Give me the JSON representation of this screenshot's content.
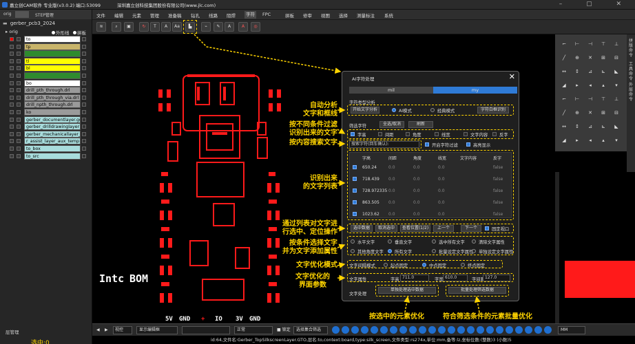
{
  "titlebar": {
    "app_title": "嘉立创CAM软件 专业版(v3.0.2) 端口:53099",
    "company": "深圳嘉立创科技集团股份有限公司(www.jlc.com)"
  },
  "left_panel": {
    "tabs": [
      "orig",
      "",
      "STEP管理"
    ],
    "project": "gerber_pcb3_2024",
    "header_left": "orig",
    "header_outline": "外形线",
    "header_board": "拼板",
    "layers": [
      {
        "name": "to",
        "color": "#ffffff"
      },
      {
        "name": "tp",
        "color": "#c8b46a"
      },
      {
        "name": "",
        "color": "#2e8b2e"
      },
      {
        "name": "tl",
        "color": "#ffff00"
      },
      {
        "name": "bl",
        "color": "#ffff00"
      },
      {
        "name": "",
        "color": "#2e8b2e"
      },
      {
        "name": "bo",
        "color": "#ffffff"
      },
      {
        "name": "drill_pth_through.drl",
        "color": "#9a9a9a"
      },
      {
        "name": "drill_pth_through_via.drl",
        "color": "#9a9a9a"
      },
      {
        "name": "drill_npth_through.drl",
        "color": "#9a9a9a"
      },
      {
        "name": "ko",
        "color": "#9a9a9a"
      },
      {
        "name": "gerber_documentlayer.gd",
        "color": "#a8dcdc"
      },
      {
        "name": "gerber_drilldrawinglayer",
        "color": "#a8dcdc"
      },
      {
        "name": "gerber_mechanicallayer_",
        "color": "#a8dcdc"
      },
      {
        "name": "r_assist_layer_aux_temp",
        "color": "#a8dcdc"
      },
      {
        "name": "to_box",
        "color": "#a8dcdc"
      },
      {
        "name": "to_src",
        "color": "#a8dcdc"
      }
    ],
    "layer_manager": "层管理",
    "selected_count": "选中:0"
  },
  "menu": [
    "文件",
    "编辑",
    "元素",
    "管理",
    "准备稿",
    "钻孔",
    "线路",
    "阻焊",
    "字符",
    "FPC",
    "拼板",
    "修审",
    "视图",
    "选择",
    "测量标注",
    "系统"
  ],
  "menu_active_index": 8,
  "toolbar": {
    "buttons": [
      "layers-icon",
      "zoom-icon",
      "panel-icon",
      "rotate-icon",
      "text-icon",
      "text-A-icon",
      "text-Aa-icon",
      "ai-text-icon",
      "ai-text-process-icon",
      "edit-text-icon",
      "font-icon",
      "text-A-red-icon",
      "target-icon"
    ]
  },
  "dialog": {
    "title": "AI字符处理",
    "modes": [
      "mil",
      "my"
    ],
    "active_mode": "my",
    "section_type": "字符类型分析",
    "btn_start_analysis": "开始文字分析",
    "radio_ai": "AI模式",
    "radio_classic": "经典模式",
    "btn_text_config": "字符白框识别",
    "section_filter": "筛选字符",
    "btn_select_all": "全选/取消",
    "btn_refresh": "刷新",
    "filters": [
      {
        "label": "字高",
        "checked": true
      },
      {
        "label": "间距",
        "checked": false
      },
      {
        "label": "角度",
        "checked": false
      },
      {
        "label": "线宽",
        "checked": false
      },
      {
        "label": "文字内容",
        "checked": false
      },
      {
        "label": "反字",
        "checked": false
      }
    ],
    "search_placeholder": "搜索字符(回车确认):",
    "cb_search_filter": "开启字符过滤",
    "cb_highlight": "高亮显示",
    "table_headers": [
      "字高",
      "间距",
      "角度",
      "线宽",
      "文字内容",
      "反字"
    ],
    "table_rows": [
      [
        "650.24",
        "0.0",
        "0.0",
        "0.0",
        "",
        "false"
      ],
      [
        "718.439",
        "0.0",
        "0.0",
        "0.0",
        "",
        "false"
      ],
      [
        "728.972335",
        "0.0",
        "0.0",
        "0.0",
        "",
        "false"
      ],
      [
        "863.505",
        "0.0",
        "0.0",
        "0.0",
        "",
        "false"
      ],
      [
        "1023.62",
        "0.0",
        "0.0",
        "0.0",
        "",
        "false"
      ]
    ],
    "btn_select_data": "选中数据",
    "btn_cancel_select": "取消选中",
    "btn_view_pos": "查看位置(1/2)",
    "btn_prev": "上一个",
    "btn_next": "下一个",
    "cb_fixed_window": "固定视口",
    "cond_options": [
      "水平文字",
      "垂直文字",
      "选中所有文字",
      "清除文字属性",
      "其他角度文字",
      "所有文字",
      "批量设定文字属性",
      "单独设定文字属性"
    ],
    "opt_label": "文字间隔模式",
    "opt_modes": [
      "起点固定",
      "中点固定",
      "终点固定"
    ],
    "opt_active": "中点固定",
    "params_label": "文字属性",
    "param_height_label": "字高",
    "param_height": "711.0",
    "param_width_label": "字宽",
    "param_width": "610.0",
    "param_linewidth_label": "字间距",
    "param_linewidth": "127.0",
    "process_label": "文字处理",
    "btn_single": "单独处理选中数据",
    "btn_batch": "批量处理筛选数据"
  },
  "annotations": {
    "a1": "自动分析\n文字和框线",
    "a2": "按不同条件过滤\n识别出来的文字",
    "a3": "按内容搜索文字",
    "a4": "识别出来\n的文字列表",
    "a5": "通过列表对文字进\n行选中、定位操作",
    "a6": "按条件选择文字\n并为文字添加属性",
    "a7": "文字优化模式",
    "a8": "文字优化的\n界面参数",
    "a9": "按选中的元素优化",
    "a10": "符合筛选条件的元素批量优化"
  },
  "pcb_labels": {
    "intc": "Intc",
    "bom": "BOM",
    "bottom": [
      "5V",
      "GND",
      "+",
      "IO",
      "3V",
      "GND"
    ]
  },
  "bottom_bar": {
    "view_mode": "视控",
    "display_btn": "显示编辑框",
    "edit_mode": "正常",
    "lock": "锁定",
    "select_mode": "选择集合筛选",
    "unit": "MM"
  },
  "status_text": "id:64,文件名:Gerber_TopSilkscreenLayer.GTO,层名:to,context:board,type:silk_screen,文件类型:rs274x,单位:mm,备等:lz,坐标位数:(整数)3 (小数)5",
  "right_panel": {
    "tabs": [
      "拼版命令",
      "工具命令",
      "外层命令"
    ]
  }
}
